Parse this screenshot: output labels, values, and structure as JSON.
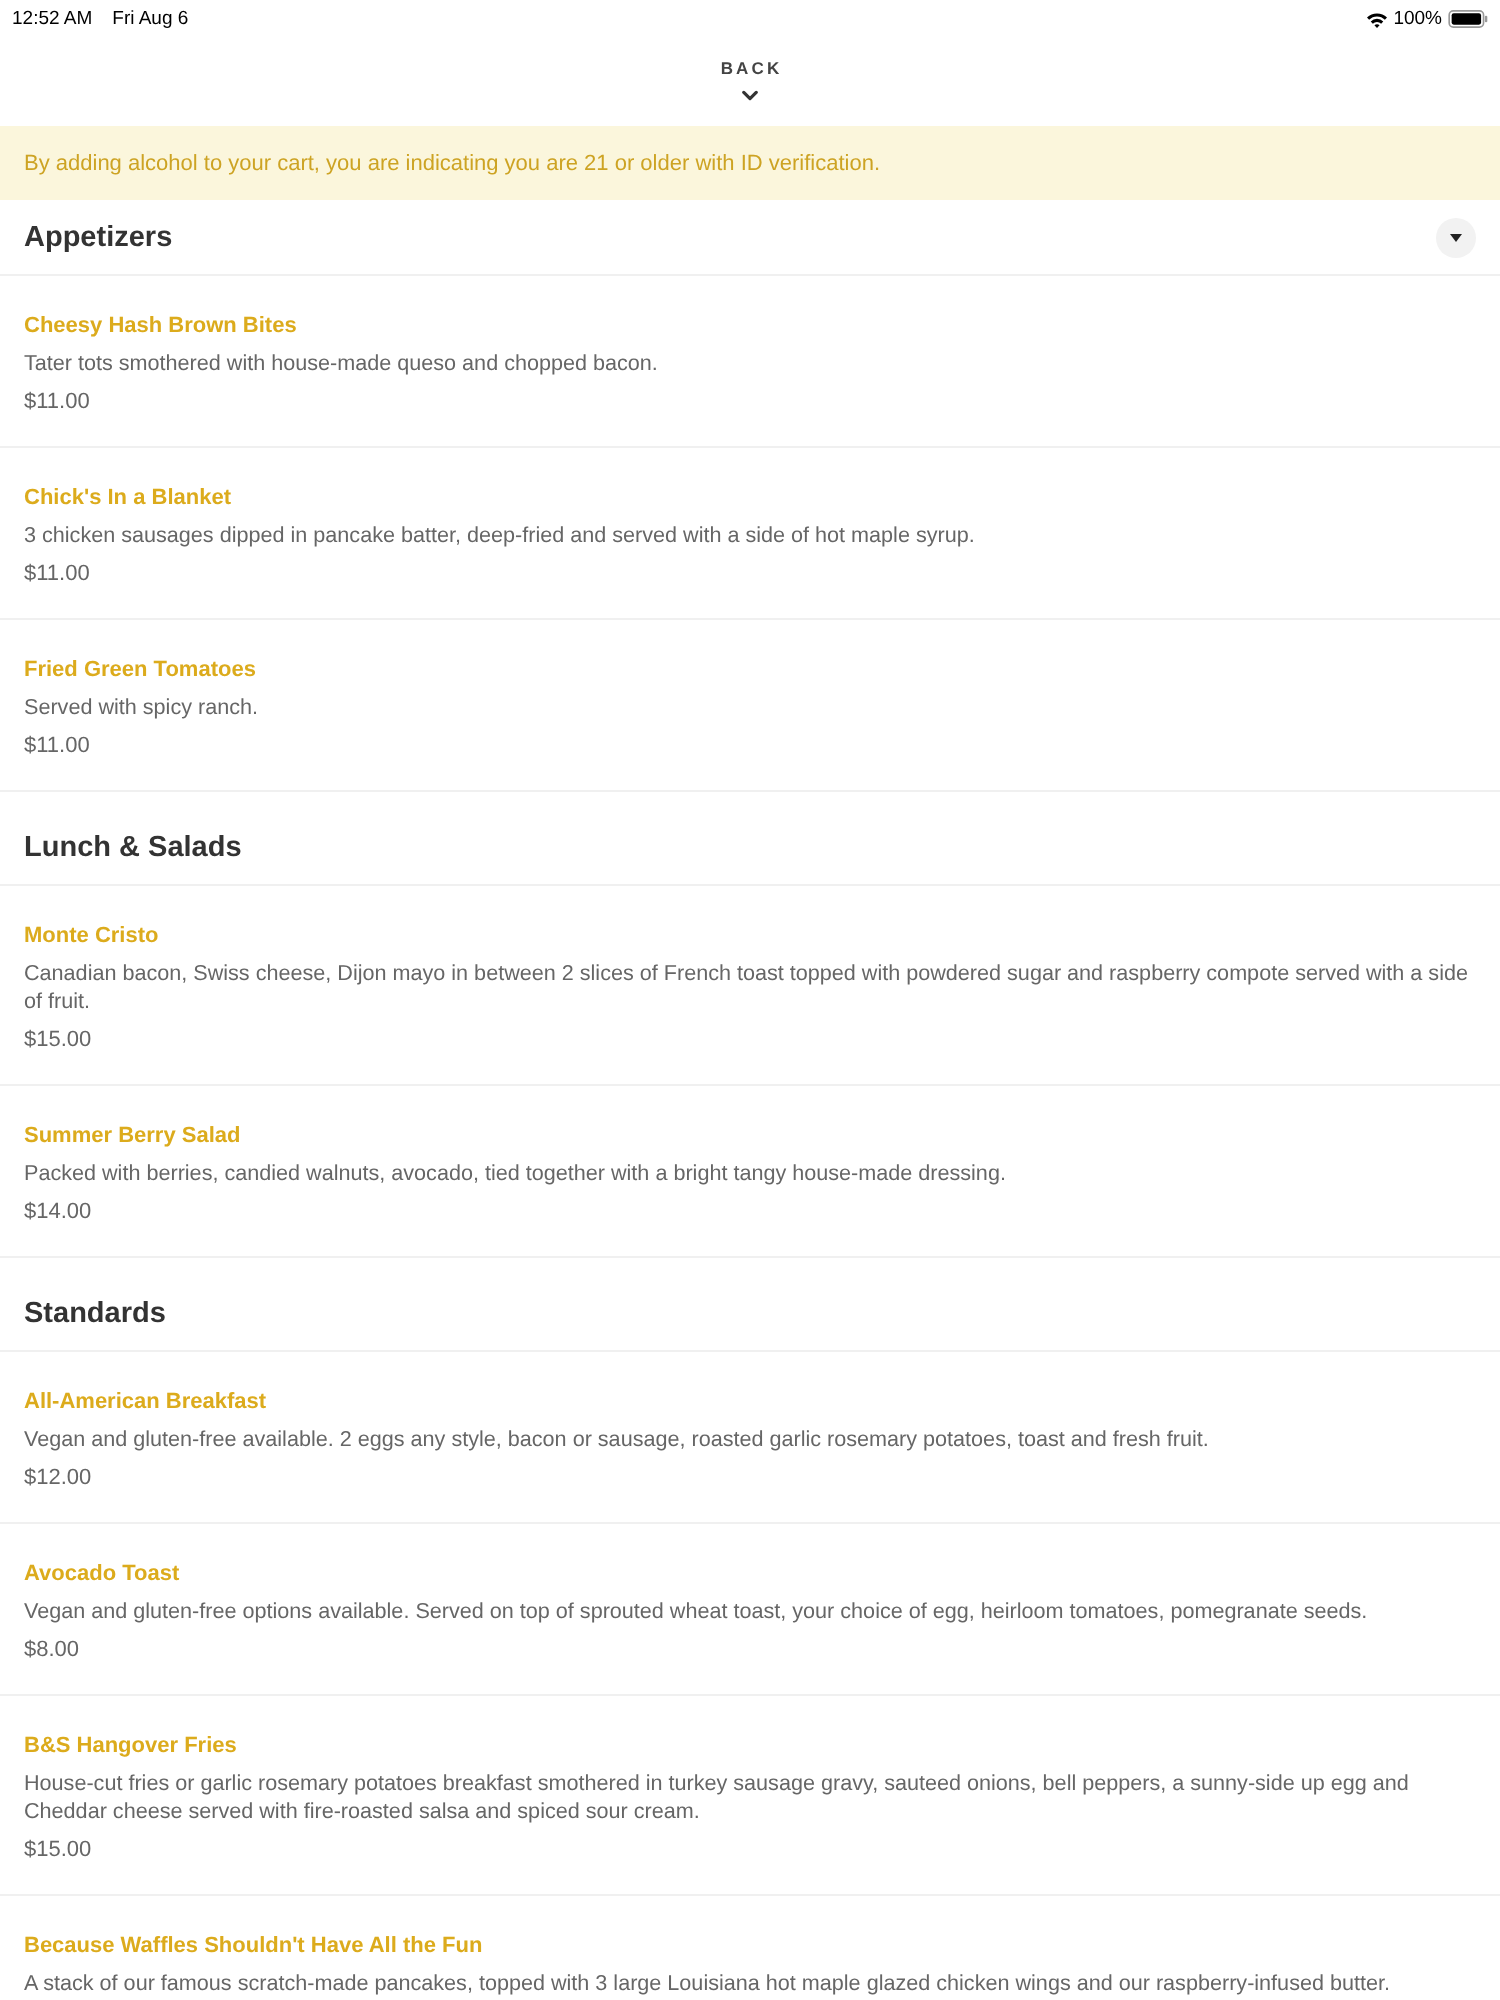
{
  "status_bar": {
    "time": "12:52 AM",
    "date": "Fri Aug 6",
    "battery": "100%"
  },
  "header": {
    "back_label": "BACK"
  },
  "notice": "By adding alcohol to your cart, you are indicating you are 21 or older with ID verification.",
  "sections": [
    {
      "title": "Appetizers",
      "dropdown": true,
      "items": [
        {
          "name": "Cheesy Hash Brown Bites",
          "description": "Tater tots smothered with house-made queso and chopped bacon.",
          "price": "$11.00"
        },
        {
          "name": "Chick's In a Blanket",
          "description": "3 chicken sausages dipped in pancake batter, deep-fried and served with a side of hot maple syrup.",
          "price": "$11.00"
        },
        {
          "name": "Fried Green Tomatoes",
          "description": "Served with spicy ranch.",
          "price": "$11.00"
        }
      ]
    },
    {
      "title": "Lunch & Salads",
      "dropdown": false,
      "items": [
        {
          "name": "Monte Cristo",
          "description": "Canadian bacon, Swiss cheese, Dijon mayo in between 2 slices of French toast topped with powdered sugar and raspberry compote served with a side of fruit.",
          "price": "$15.00"
        },
        {
          "name": "Summer Berry Salad",
          "description": "Packed with berries, candied walnuts, avocado, tied together with a bright tangy house-made dressing.",
          "price": "$14.00"
        }
      ]
    },
    {
      "title": "Standards",
      "dropdown": false,
      "items": [
        {
          "name": "All-American Breakfast",
          "description": "Vegan and gluten-free available. 2 eggs any style, bacon or sausage, roasted garlic rosemary potatoes, toast and fresh fruit.",
          "price": "$12.00"
        },
        {
          "name": "Avocado Toast",
          "description": "Vegan and gluten-free options available. Served on top of sprouted wheat toast, your choice of egg, heirloom tomatoes, pomegranate seeds.",
          "price": "$8.00"
        },
        {
          "name": "B&S Hangover Fries",
          "description": "House-cut fries or garlic rosemary potatoes breakfast smothered in turkey sausage gravy, sauteed onions, bell peppers, a sunny-side up egg and Cheddar cheese served with fire-roasted salsa and spiced sour cream.",
          "price": "$15.00"
        },
        {
          "name": "Because Waffles Shouldn't Have All the Fun",
          "description": "A stack of our famous scratch-made pancakes, topped with 3 large Louisiana hot maple glazed chicken wings and our raspberry-infused butter."
        }
      ]
    }
  ]
}
